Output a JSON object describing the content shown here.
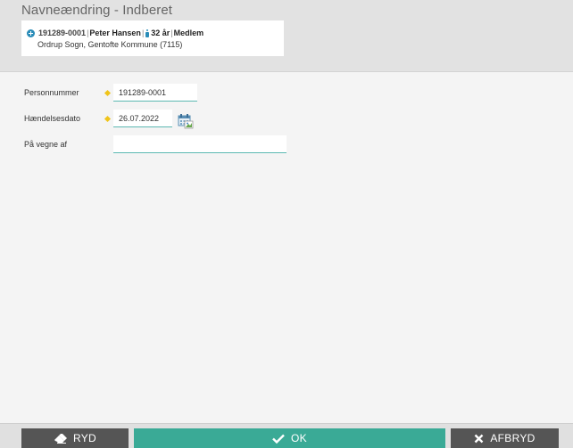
{
  "header": {
    "title": "Navneændring - Indberet",
    "person": {
      "cpr": "191289-0001",
      "name": "Peter Hansen",
      "age": "32 år",
      "status": "Medlem",
      "parish": "Ordrup Sogn, Gentofte Kommune (7115)"
    }
  },
  "form": {
    "personnummer_label": "Personnummer",
    "personnummer_value": "191289-0001",
    "dato_label": "Hændelsesdato",
    "dato_value": "26.07.2022",
    "paa_vegne_label": "På vegne af",
    "paa_vegne_value": ""
  },
  "footer": {
    "ryd_label": "RYD",
    "ok_label": "OK",
    "afbryd_label": "AFBRYD"
  },
  "icons": {
    "expand": "plus-circle-icon",
    "person": "person-icon",
    "calendar": "calendar-icon",
    "eraser": "eraser-icon",
    "check": "check-icon",
    "close": "close-icon"
  },
  "colors": {
    "accent": "#3aaa96",
    "header_bg": "#e2e2e2",
    "dark_button": "#555555",
    "required": "#f0c419",
    "link_blue": "#2a8cb8"
  }
}
